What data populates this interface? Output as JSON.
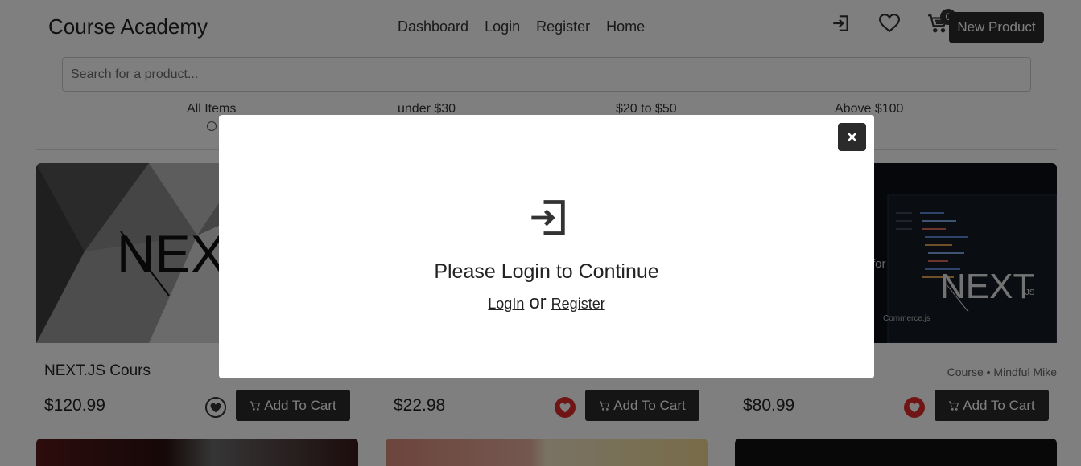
{
  "header": {
    "brand": "Course Academy",
    "nav": [
      "Dashboard",
      "Login",
      "Register",
      "Home"
    ],
    "icons": [
      "login-icon",
      "heart-icon",
      "cart-icon"
    ],
    "cart_count": "0",
    "new_product_label": "New Product"
  },
  "search": {
    "placeholder": "Search for a product..."
  },
  "filters": [
    "All Items",
    "under $30",
    "$20 to $50",
    "Above $100"
  ],
  "products": [
    {
      "title": "NEXT.JS Cours",
      "meta": "",
      "price": "$120.99",
      "favorite": false,
      "add_label": "Add To Cart"
    },
    {
      "title": "",
      "meta": "",
      "price": "$22.98",
      "favorite": true,
      "add_label": "Add To Cart"
    },
    {
      "title": "",
      "meta": "Course • Mindful Mike",
      "price": "$80.99",
      "favorite": true,
      "add_label": "Add To Cart"
    }
  ],
  "card_image_text": {
    "next_logo": "NEXT",
    "next_js_suffix": ".JS",
    "for_text": "for",
    "commerce": "Commerce.js"
  },
  "modal": {
    "title": "Please Login to Continue",
    "login_link": "LogIn",
    "or_text": "or",
    "register_link": "Register",
    "close_label": "×"
  },
  "colors": {
    "dark_button": "#2b2b2b",
    "favorite_red": "#e02b2b",
    "overlay": "rgba(0,0,0,0.5)"
  }
}
